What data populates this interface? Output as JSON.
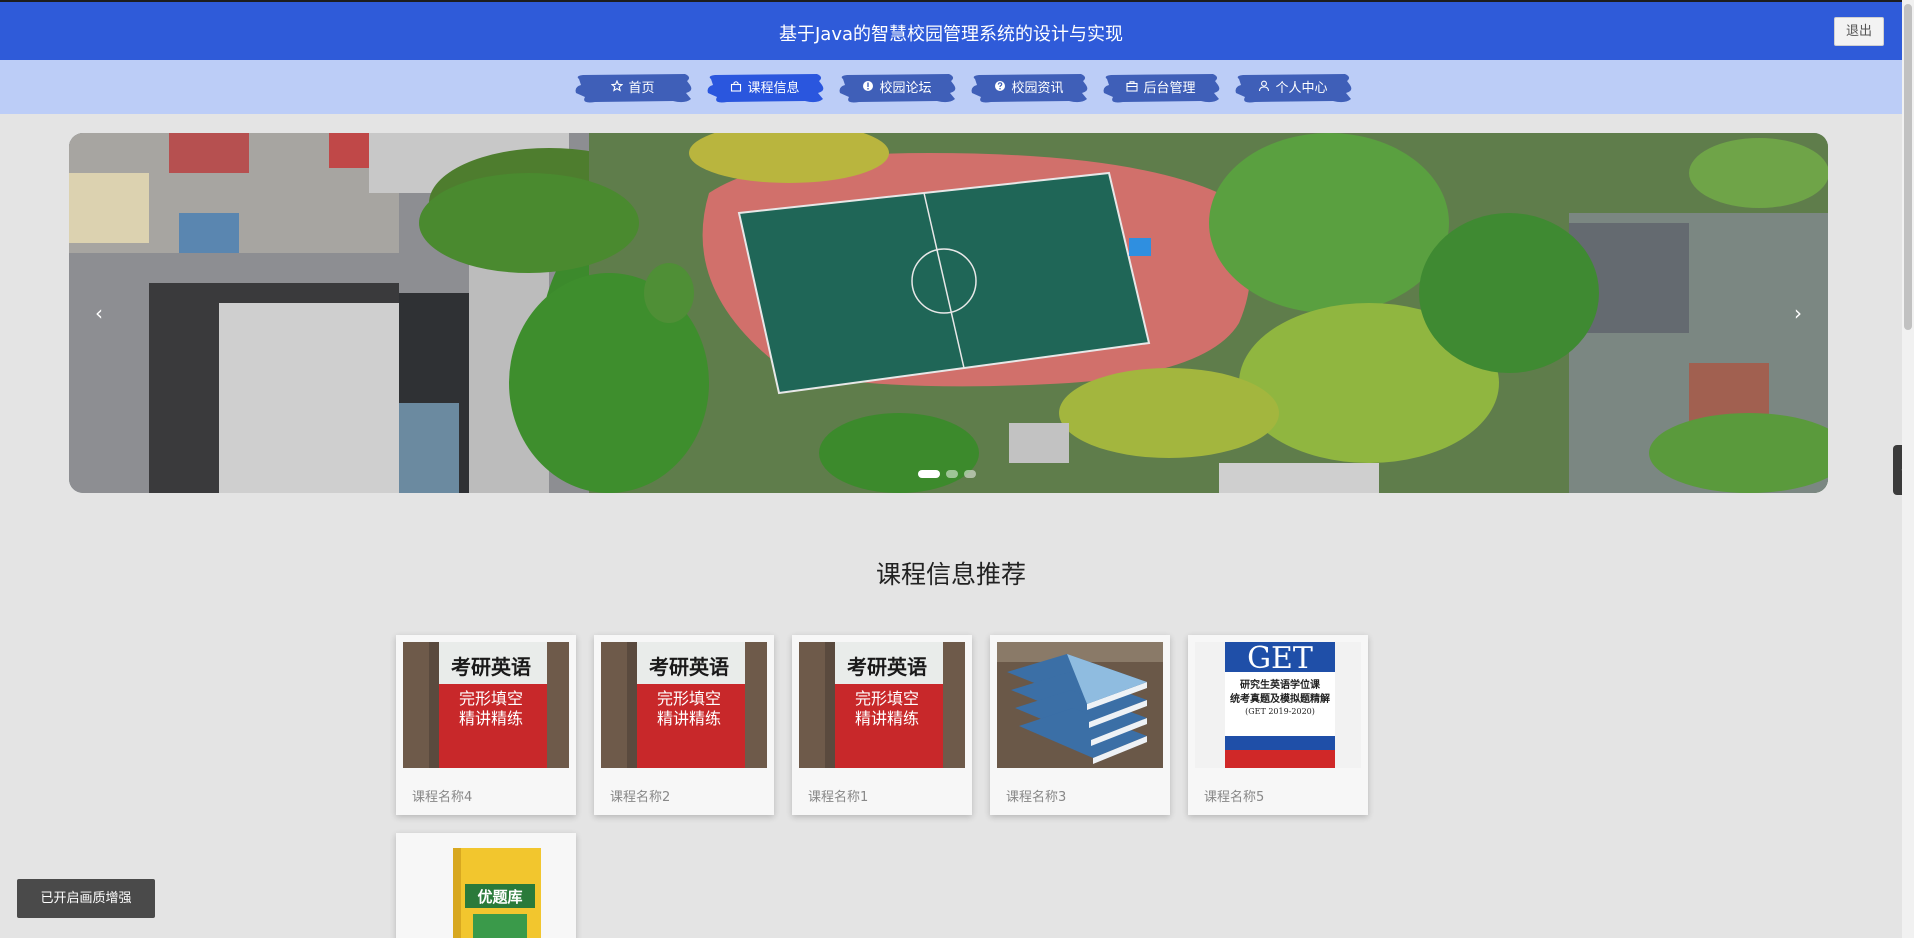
{
  "header": {
    "title": "基于Java的智慧校园管理系统的设计与实现",
    "logout_label": "退出"
  },
  "nav": {
    "items": [
      {
        "label": "首页",
        "icon": "star-icon"
      },
      {
        "label": "课程信息",
        "icon": "bag-icon"
      },
      {
        "label": "校园论坛",
        "icon": "info-icon"
      },
      {
        "label": "校园资讯",
        "icon": "help-icon"
      },
      {
        "label": "后台管理",
        "icon": "briefcase-icon"
      },
      {
        "label": "个人中心",
        "icon": "user-icon"
      }
    ],
    "active_index": 1
  },
  "carousel": {
    "prev_symbol": "‹",
    "next_symbol": "›",
    "slide_count": 3,
    "active_slide": 1
  },
  "side_tab": {
    "symbol": "‹"
  },
  "recommend": {
    "title": "课程信息推荐",
    "courses": [
      {
        "name": "课程名称4",
        "cover": "book-red"
      },
      {
        "name": "课程名称2",
        "cover": "book-red"
      },
      {
        "name": "课程名称1",
        "cover": "book-red"
      },
      {
        "name": "课程名称3",
        "cover": "book-stack"
      },
      {
        "name": "课程名称5",
        "cover": "book-get"
      },
      {
        "name": "",
        "cover": "book-yellow"
      }
    ]
  },
  "cover_texts": {
    "book_red_title": "考研英语",
    "book_red_sub1": "完形填空",
    "book_red_sub2": "精讲精练",
    "book_get_logo": "GET",
    "book_get_line1": "研究生英语学位课",
    "book_get_line2": "统考真题及模拟题精解",
    "book_get_line3": "(GET 2019-2020)",
    "book_yellow_title": "优题库"
  },
  "toast": {
    "label": "已开启画质增强"
  },
  "colors": {
    "header_bg": "#2f5bd9",
    "nav_bg": "#bccdf7",
    "nav_brush": "#3f5fb8",
    "nav_brush_active": "#2a56de",
    "page_bg": "#e4e4e4"
  }
}
